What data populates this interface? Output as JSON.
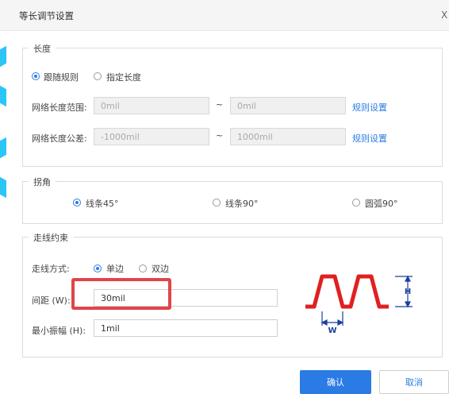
{
  "window": {
    "title": "等长调节设置",
    "close_glyph": "X"
  },
  "length_section": {
    "title": "长度",
    "mode_options": [
      {
        "label": "跟随规则",
        "checked": true
      },
      {
        "label": "指定长度",
        "checked": false
      }
    ],
    "range": {
      "label": "网络长度范围:",
      "min": "0mil",
      "max": "0mil",
      "separator": "~",
      "link": "规则设置"
    },
    "tolerance": {
      "label": "网络长度公差:",
      "min": "-1000mil",
      "max": "1000mil",
      "separator": "~",
      "link": "规则设置"
    }
  },
  "corner_section": {
    "title": "拐角",
    "options": [
      {
        "label": "线条45°",
        "checked": true
      },
      {
        "label": "线条90°",
        "checked": false
      },
      {
        "label": "圆弧90°",
        "checked": false
      }
    ]
  },
  "routing_section": {
    "title": "走线约束",
    "style": {
      "label": "走线方式:",
      "options": [
        {
          "label": "单边",
          "checked": true
        },
        {
          "label": "双边",
          "checked": false
        }
      ]
    },
    "gap": {
      "label": "间距 (W):",
      "value": "30mil"
    },
    "amplitude": {
      "label": "最小振幅 (H):",
      "value": "1mil"
    },
    "diagram": {
      "h_label": "H",
      "w_label": "W",
      "trace_color": "#e02020",
      "dim_color": "#1a3fa0"
    }
  },
  "buttons": {
    "ok": "确认",
    "cancel": "取消"
  },
  "colors": {
    "accent": "#2a7be4",
    "highlight": "#e0454b"
  }
}
